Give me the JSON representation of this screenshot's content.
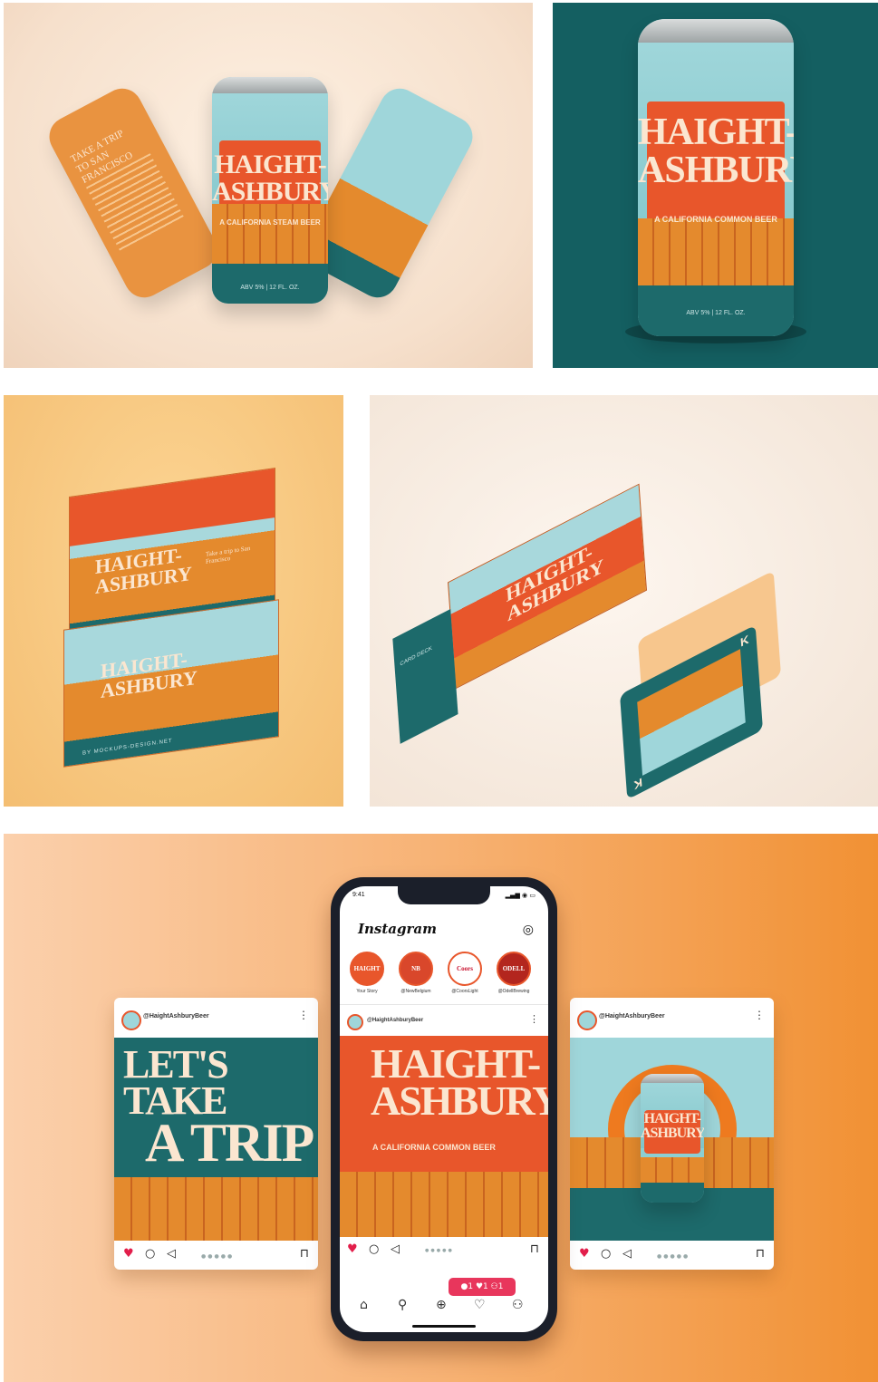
{
  "brand": {
    "name_line1": "HAIGHT-",
    "name_line2": "ASHBURY",
    "steam_tag": "A CALIFORNIA STEAM BEER",
    "common_tag": "A CALIFORNIA COMMON BEER",
    "abv": "ABV 5% | 12 FL. OZ."
  },
  "side_can": {
    "text": "TAKE A TRIP TO SAN FRANCISCO"
  },
  "box": {
    "side_text": "Take a trip to San Francisco",
    "mockup": "BY MOCKUPS-DESIGN.NET"
  },
  "card_deck": {
    "label": "CARD DECK",
    "king": "K"
  },
  "instagram": {
    "status_time": "9:41",
    "status_icons": "▂▄▆ ◉ ▭",
    "logo": "Instagram",
    "messenger_icon": "◎",
    "stories": [
      {
        "label": "Your Story",
        "badge": "HAIGHT"
      },
      {
        "label": "@NewBelgium",
        "badge": "NB"
      },
      {
        "label": "@CoorsLight",
        "badge": "Coors"
      },
      {
        "label": "@OdellBrewing",
        "badge": "ODELL"
      }
    ],
    "username": "@HaightAshburyBeer",
    "post_left": {
      "line1": "LET'S TAKE",
      "line2": "A TRIP"
    },
    "notification": "●1 ♥1 ⚇1",
    "icons": {
      "heart": "♥",
      "comment": "○",
      "share": "◁",
      "save": "⊓",
      "more": "⋮",
      "pager": "●●●●●",
      "home": "⌂",
      "search": "⚲",
      "add": "⊕",
      "activity": "♡",
      "profile": "⚇"
    }
  },
  "colors": {
    "orange_red": "#e8562b",
    "teal": "#1d6a6b",
    "sky": "#9fd6da",
    "cream": "#fbe6d0",
    "heart": "#e21e4b"
  }
}
